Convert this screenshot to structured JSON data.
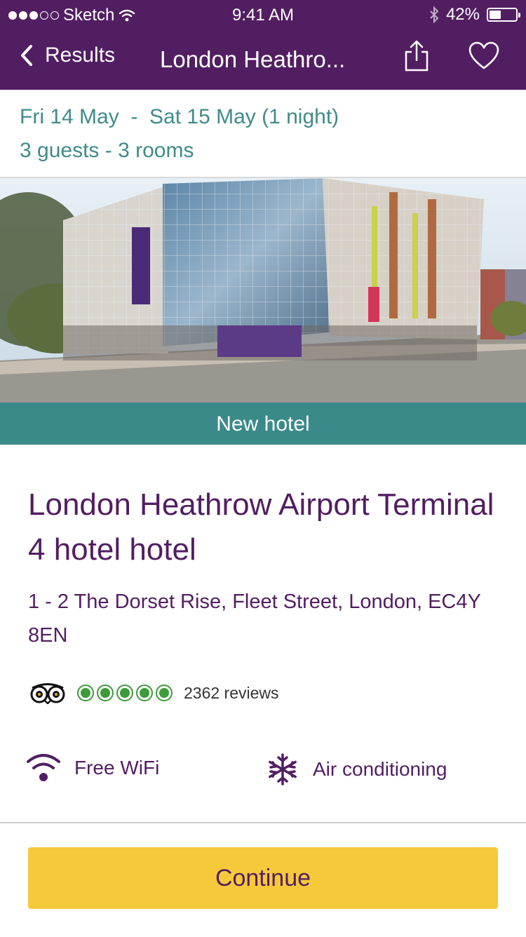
{
  "status_bar": {
    "carrier": "Sketch",
    "time": "9:41 AM",
    "battery": "42%"
  },
  "nav": {
    "back_label": "Results",
    "title": "London Heathro..."
  },
  "booking": {
    "dates": "Fri 14 May  -  Sat 15 May (1 night)",
    "guests": "3 guests - 3 rooms"
  },
  "badge": "New hotel",
  "hotel": {
    "name": "London Heathrow Airport Terminal 4 hotel hotel",
    "address": "1 - 2 The Dorset Rise, Fleet Street, London, EC4Y 8EN"
  },
  "rating": {
    "bubbles": 5,
    "max": 5,
    "reviews": "2362 reviews"
  },
  "amenities": [
    {
      "label": "Free WiFi",
      "icon": "wifi-icon"
    },
    {
      "label": "Air conditioning",
      "icon": "snowflake-icon"
    }
  ],
  "cta": {
    "label": "Continue"
  },
  "colors": {
    "brand": "#521e62",
    "teal": "#3a8a89",
    "cta": "#f6c93a",
    "rating": "#3e9a3b"
  }
}
